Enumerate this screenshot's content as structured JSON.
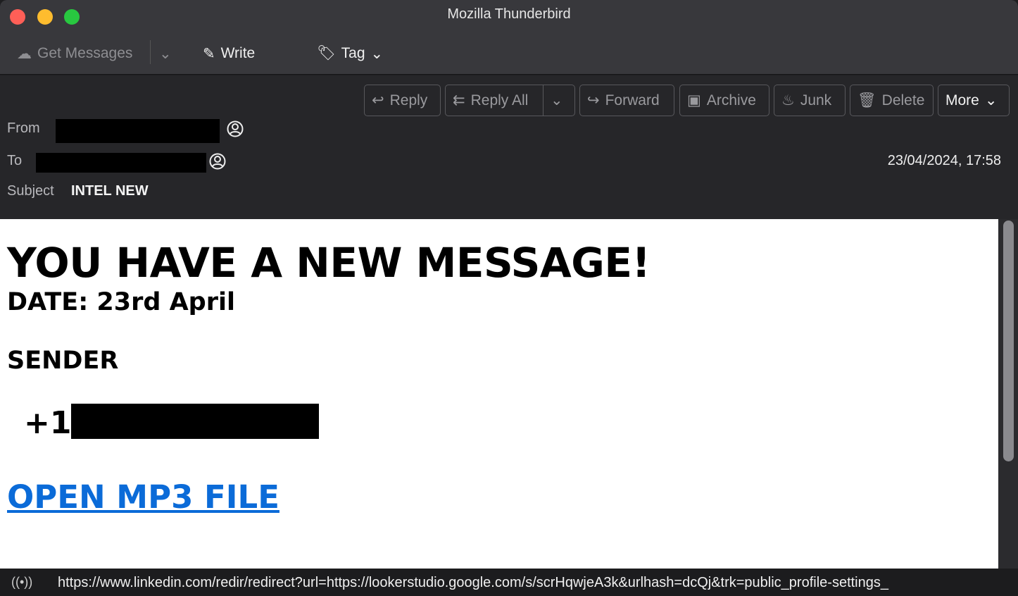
{
  "window": {
    "title": "Mozilla Thunderbird",
    "colors": {
      "close": "#fe5f57",
      "minimize": "#febc2e",
      "zoom": "#28c840"
    }
  },
  "toolbar": {
    "get_messages": "Get Messages",
    "write": "Write",
    "tag": "Tag"
  },
  "actions": {
    "reply": "Reply",
    "reply_all": "Reply All",
    "forward": "Forward",
    "archive": "Archive",
    "junk": "Junk",
    "delete": "Delete",
    "more": "More"
  },
  "header": {
    "from_label": "From",
    "to_label": "To",
    "subject_label": "Subject",
    "subject": "INTEL NEW",
    "date": "23/04/2024, 17:58"
  },
  "message": {
    "headline": "YOU HAVE A NEW MESSAGE!",
    "date_line": "DATE: 23rd April",
    "sender_label": "SENDER",
    "phone_prefix": "+1",
    "link_text": "OPEN MP3 FILE",
    "link_color": "#0b6bd8"
  },
  "status": {
    "url": "https://www.linkedin.com/redir/redirect?url=https://lookerstudio.google.com/s/scrHqwjeA3k&urlhash=dcQj&trk=public_profile-settings_"
  }
}
